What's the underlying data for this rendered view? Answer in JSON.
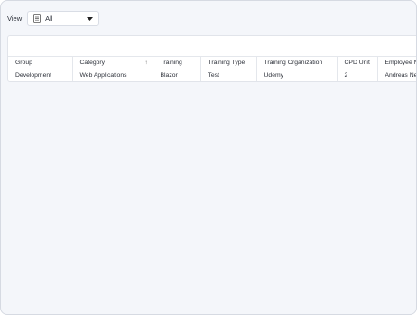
{
  "toolbar": {
    "view_label": "View",
    "view_value": "All",
    "view_icon": "list-icon",
    "dropdown_icon": "caret-down-icon"
  },
  "grid": {
    "columns": [
      "Group",
      "Category",
      "Training",
      "Training Type",
      "Training Organization",
      "CPD Unit",
      "Employee N"
    ],
    "sort": {
      "column": "Category",
      "direction": "ascending",
      "icon": "sort-up-icon"
    },
    "rows": [
      [
        "Development",
        "Web Applications",
        "Blazor",
        "Test",
        "Udemy",
        "2",
        "Andreas Ne"
      ]
    ]
  }
}
